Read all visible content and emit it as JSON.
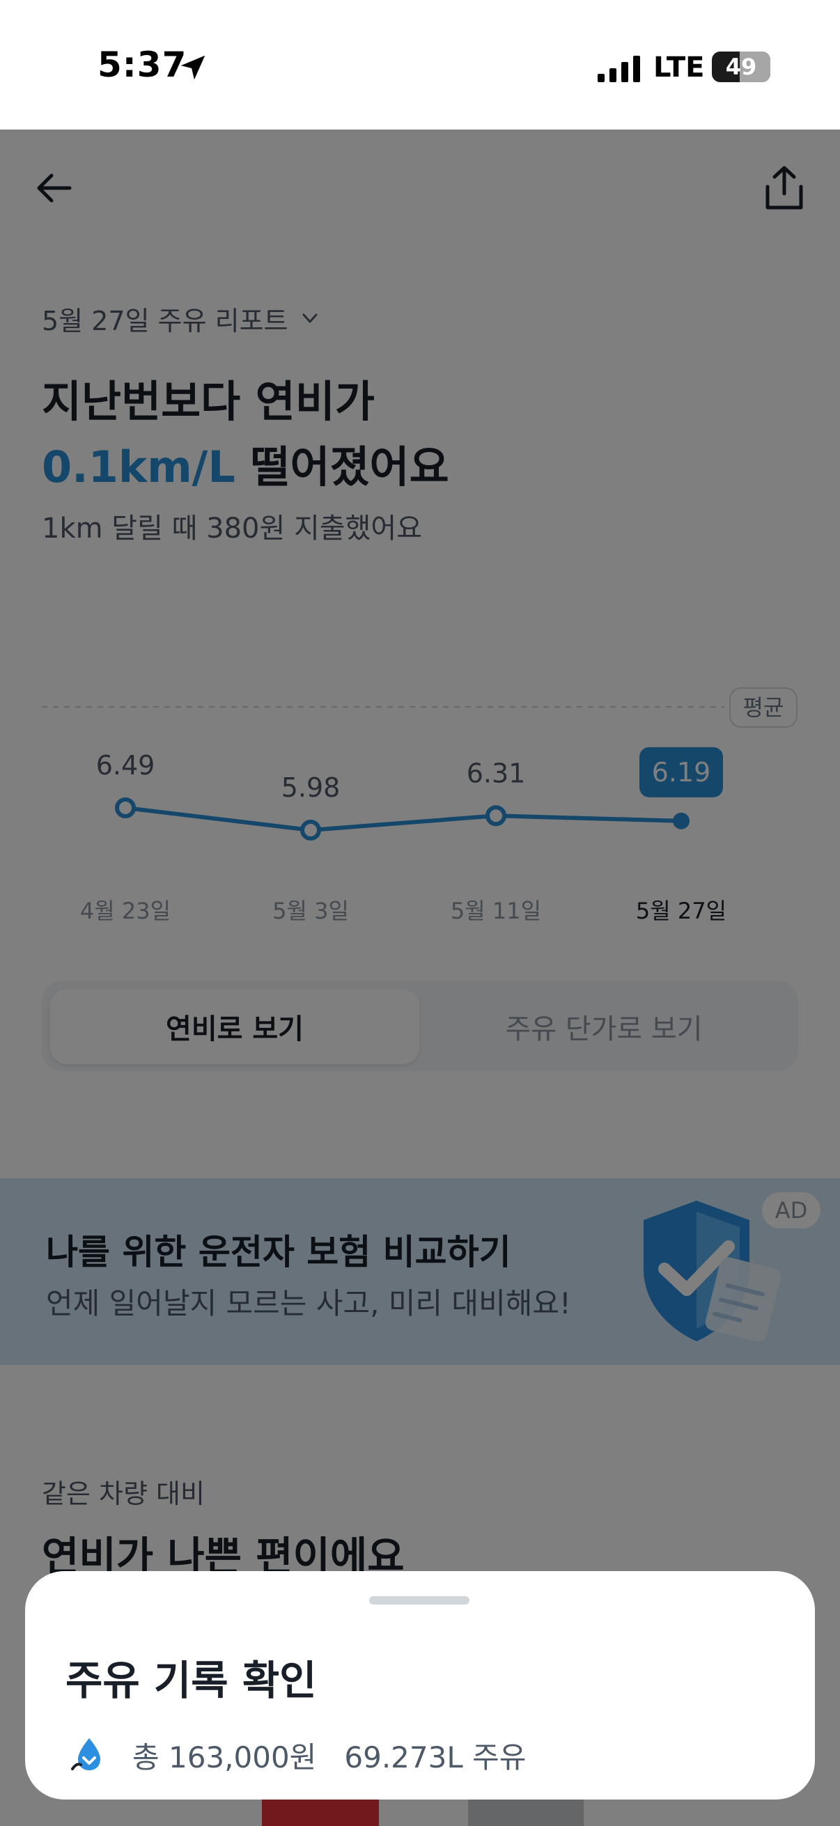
{
  "status_bar": {
    "time": "5:37",
    "network": "LTE",
    "battery": "49"
  },
  "header": {
    "back_icon": "arrow-left-icon",
    "share_icon": "share-icon"
  },
  "report": {
    "title": "5월 27일 주유 리포트",
    "headline_line1": "지난번보다 연비가",
    "headline_highlight": "0.1km/L",
    "headline_rest": " 떨어졌어요",
    "subtitle": "1km 달릴 때 380원 지출했어요",
    "accent_color": "#2a8fd6"
  },
  "chart_data": {
    "type": "line",
    "categories": [
      "4월 23일",
      "5월 3일",
      "5월 11일",
      "5월 27일"
    ],
    "values": [
      6.49,
      5.98,
      6.31,
      6.19
    ],
    "value_labels": [
      "6.49",
      "5.98",
      "6.31",
      "6.19"
    ],
    "average_label": "평균",
    "highlight_index": 3,
    "line_color": "#2a8fd6"
  },
  "toggle": {
    "options": [
      "연비로 보기",
      "주유 단가로 보기"
    ],
    "selected": 0
  },
  "ad": {
    "title": "나를 위한 운전자 보험 비교하기",
    "description": "언제 일어날지 모르는 사고, 미리 대비해요!",
    "badge": "AD",
    "icon": "shield-check-icon"
  },
  "comparison": {
    "label": "같은 차량 대비",
    "title": "연비가 나쁜 편이에요"
  },
  "sheet": {
    "title": "주유 기록 확인",
    "icon": "fuel-drop-icon",
    "total": "총 163,000원",
    "volume": "69.273L 주유"
  }
}
